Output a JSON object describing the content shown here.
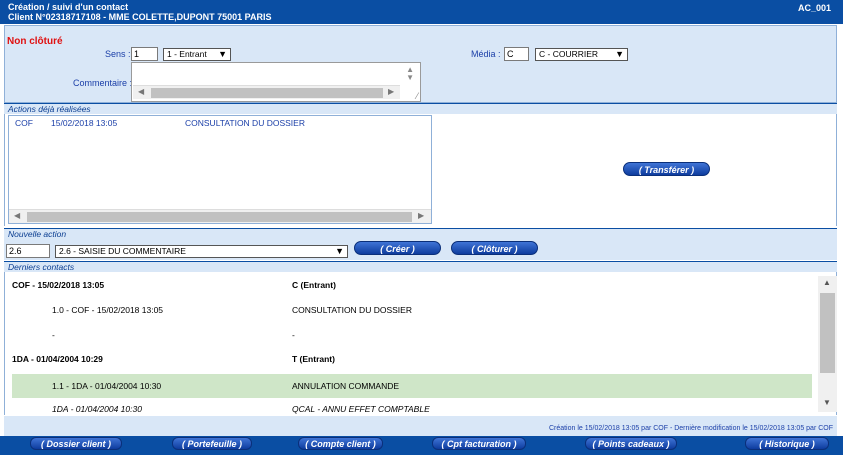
{
  "title": {
    "line1": "Création / suivi d'un contact",
    "line2": "Client N°02318717108 - MME COLETTE,DUPONT 75001 PARIS",
    "code": "AC_001"
  },
  "contact": {
    "status": "Non clôturé",
    "sens_label": "Sens :",
    "sens_value": "1",
    "sens_select": "1 - Entrant",
    "media_label": "Média :",
    "media_value": "C",
    "media_select": "C - COURRIER",
    "comment_label": "Commentaire :",
    "comment_value": ""
  },
  "actions": {
    "header": "Actions déjà réalisées",
    "rows": [
      {
        "code": "COF",
        "date": "15/02/2018 13:05",
        "label": "CONSULTATION DU DOSSIER"
      }
    ],
    "transfer_button": "( Transférer )"
  },
  "new_action": {
    "header": "Nouvelle action",
    "code_value": "2.6",
    "select": "2.6 - SAISIE DU COMMENTAIRE",
    "create_button": "( Créer )",
    "close_button": "( Clôturer )"
  },
  "last_contacts": {
    "header": "Derniers contacts",
    "rows": [
      {
        "left": "COF - 15/02/2018 13:05",
        "right": "C (Entrant)",
        "type": "header"
      },
      {
        "left": "1.0 - COF - 15/02/2018 13:05",
        "right": "CONSULTATION DU DOSSIER",
        "type": "detail"
      },
      {
        "left": "-",
        "right": "-",
        "type": "detail"
      },
      {
        "left": "1DA - 01/04/2004 10:29",
        "right": "T (Entrant)",
        "type": "header"
      },
      {
        "left": "1.1 - 1DA - 01/04/2004 10:30",
        "right": "ANNULATION COMMANDE",
        "type": "selected"
      },
      {
        "left": "1DA - 01/04/2004 10:30",
        "right": "QCAL - ANNU EFFET COMPTABLE",
        "type": "italic"
      }
    ]
  },
  "footer_info": "Création le 15/02/2018 13:05 par COF - Dernière modification le 15/02/2018 13:05 par COF",
  "bottom_buttons": [
    "( Dossier client )",
    "( Portefeuille )",
    "( Compte client )",
    "( Cpt facturation )",
    "( Points cadeaux )",
    "( Historique )"
  ],
  "colors": {
    "title_bg": "#0a4ea3",
    "panel_bg": "#d9e7f7",
    "status_red": "#e01010",
    "selected_row": "#cfe6c8"
  }
}
